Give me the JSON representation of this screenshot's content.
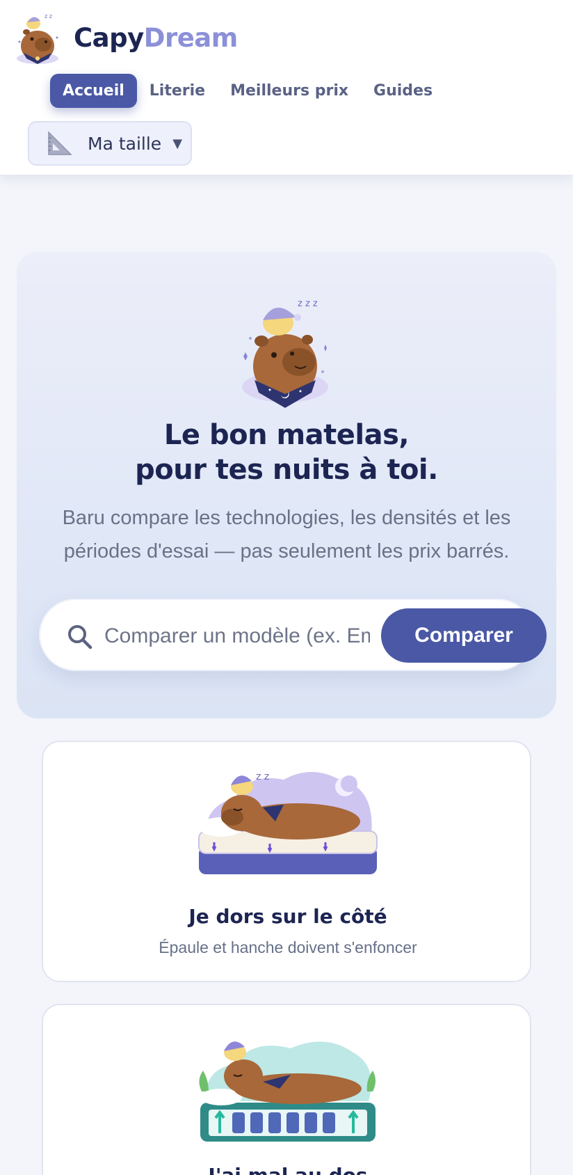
{
  "brand": {
    "name_part1": "Capy",
    "name_part2": "Dream"
  },
  "nav": {
    "items": [
      {
        "label": "Accueil",
        "active": true
      },
      {
        "label": "Literie",
        "active": false
      },
      {
        "label": "Meilleurs prix",
        "active": false
      },
      {
        "label": "Guides",
        "active": false
      }
    ],
    "size_button": {
      "label": "Ma taille",
      "icon": "ruler-triangle-icon",
      "caret": "▼"
    }
  },
  "hero": {
    "title_line1": "Le bon matelas,",
    "title_line2": "pour tes nuits à toi.",
    "subtitle": "Baru compare les technologies, les densités et les périodes d'essai — pas seulement les prix barrés.",
    "search": {
      "placeholder": "Comparer un modèle (ex. Emma, Tediber…)",
      "button_label": "Comparer",
      "icon": "search-icon"
    }
  },
  "cards": [
    {
      "title": "Je dors sur le côté",
      "description": "Épaule et hanche doivent s'enfoncer",
      "illustration": "capybara-side-sleeper-mattress"
    },
    {
      "title": "J'ai mal au dos",
      "description": "",
      "illustration": "capybara-back-support-mattress"
    }
  ],
  "colors": {
    "accent": "#4a58a6",
    "brand_light": "#8c90d8",
    "ink": "#1c2552"
  }
}
